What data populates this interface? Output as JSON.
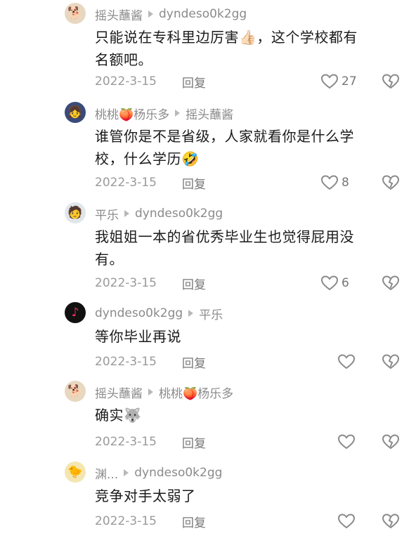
{
  "comments": [
    {
      "author": "摇头蘸酱",
      "reply_to": "dyndeso0k2gg",
      "text_line1": "只能说在专科里边厉害",
      "emoji1": "👍🏻",
      "text_line1b": "，这个学校都有",
      "text_line2": "名额吧。",
      "date": "2022-3-15",
      "reply_label": "回复",
      "likes": "27"
    },
    {
      "author": "桃桃🍑杨乐多",
      "reply_to": "摇头蘸酱",
      "text_line1": "谁管你是不是省级，人家就看你是什么学",
      "text_line2": "校，什么学历",
      "emoji2": "🤣",
      "date": "2022-3-15",
      "reply_label": "回复",
      "likes": "8"
    },
    {
      "author": "平乐",
      "reply_to": "dyndeso0k2gg",
      "text_line1": "我姐姐一本的省优秀毕业生也觉得屁用没",
      "text_line2": "有。",
      "date": "2022-3-15",
      "reply_label": "回复",
      "likes": "6"
    },
    {
      "author": "dyndeso0k2gg",
      "reply_to": "平乐",
      "text_line1": "等你毕业再说",
      "date": "2022-3-15",
      "reply_label": "回复"
    },
    {
      "author": "摇头蘸酱",
      "reply_to": "桃桃🍑杨乐多",
      "text_line1": "确实",
      "emoji1": "🐺",
      "date": "2022-3-15",
      "reply_label": "回复"
    },
    {
      "author": "渊...",
      "reply_to": "dyndeso0k2gg",
      "text_line1": "竞争对手太弱了",
      "date": "2022-3-15",
      "reply_label": "回复"
    }
  ],
  "icons": {
    "avatar": "avatar",
    "arrow": "reply-arrow-icon",
    "like": "heart-icon",
    "dislike": "broken-heart-icon"
  }
}
